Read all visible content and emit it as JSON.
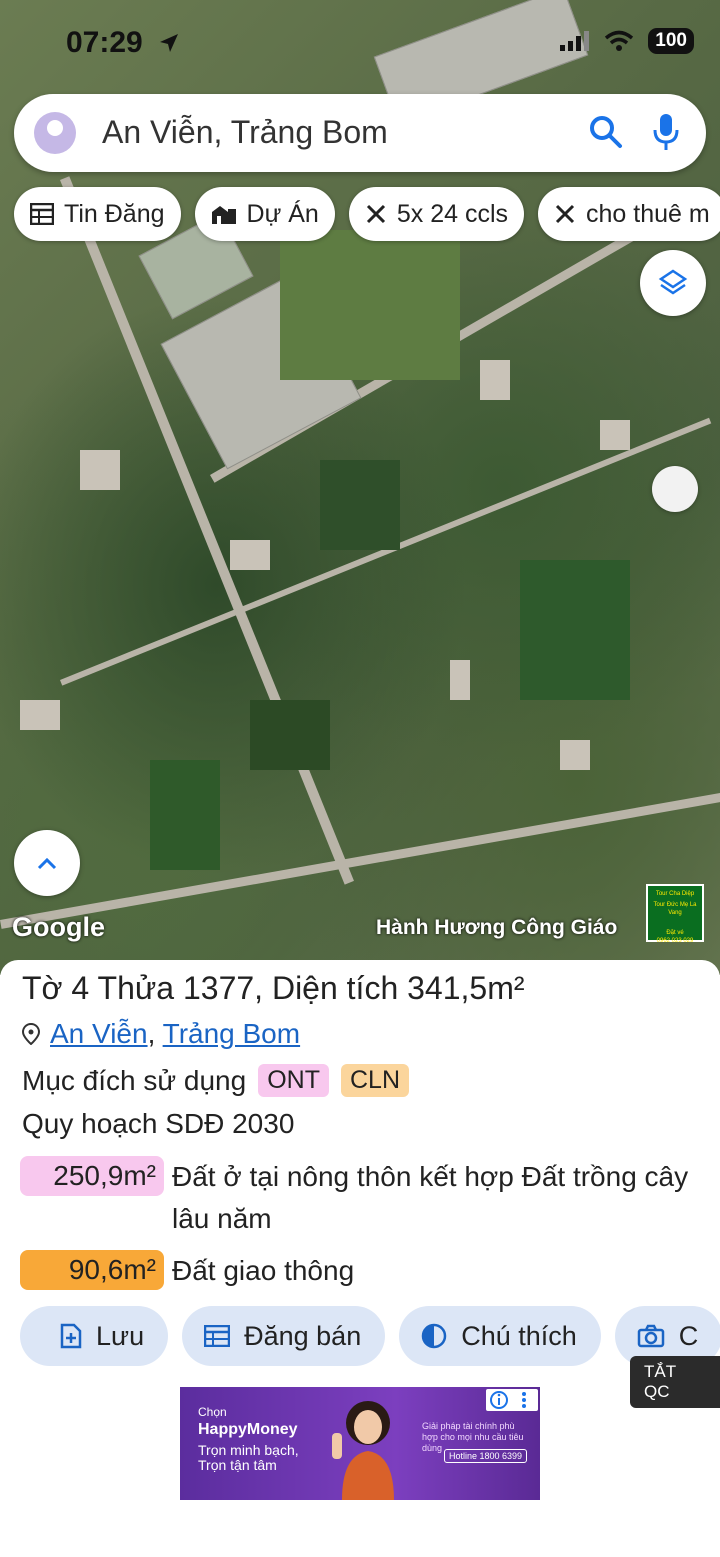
{
  "status_bar": {
    "time": "07:29",
    "battery": "100"
  },
  "search": {
    "query": "An Viễn, Trảng Bom"
  },
  "chips": [
    {
      "label": "Tin Đăng",
      "icon": "table-icon"
    },
    {
      "label": "Dự Án",
      "icon": "building-icon"
    },
    {
      "label": "5x 24 ccls",
      "icon": "ruler-icon"
    },
    {
      "label": "cho thuê m",
      "icon": "ruler-icon"
    }
  ],
  "map": {
    "google_logo": "Google",
    "attribution": "Hành Hương Công Giáo",
    "mini_ad_lines": [
      "Tour Cha Diệp",
      "Tour Đức Mẹ La Vang",
      "Đặt vé",
      "0962 023 029"
    ]
  },
  "details": {
    "title_prefix": "Tờ ",
    "sheet": "4",
    "parcel_prefix": " Thửa ",
    "parcel": "1377",
    "area_prefix": ", Diện tích ",
    "area": "341,5",
    "area_unit": "m²",
    "address_ward": "An Viễn",
    "address_sep": ",",
    "address_district": "Trảng Bom",
    "purpose_label": "Mục đích sử dụng",
    "purpose_tags": [
      "ONT",
      "CLN"
    ],
    "plan_label": "Quy hoạch SDĐ 2030",
    "areas": [
      {
        "value": "250,9m²",
        "desc": "Đất ở tại nông thôn kết hợp Đất trồng cây lâu năm",
        "color": "#f8c8ee"
      },
      {
        "value": "90,6m²",
        "desc": "Đất giao thông",
        "color": "#f8a838"
      }
    ]
  },
  "actions": [
    {
      "label": "Lưu",
      "icon": "add-file-icon"
    },
    {
      "label": "Đăng bán",
      "icon": "table-icon"
    },
    {
      "label": "Chú thích",
      "icon": "contrast-icon"
    },
    {
      "label": "C",
      "icon": "camera-icon"
    }
  ],
  "ad": {
    "close_label": "TẮT QC",
    "header": "Chọn",
    "brand": "HappyMoney",
    "tagline": "Trọn minh bạch, Trọn tận tâm",
    "side_text": "Giải pháp tài chính phù hợp cho mọi nhu cầu tiêu dùng",
    "hotline": "Hotline 1800 6399"
  }
}
